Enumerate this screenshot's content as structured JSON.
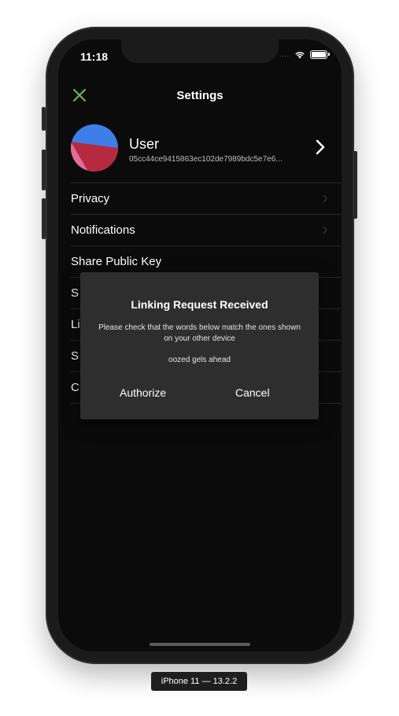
{
  "status_bar": {
    "time": "11:18",
    "signal": "....",
    "wifi_icon": "wifi-icon",
    "battery_icon": "battery-icon"
  },
  "nav": {
    "title": "Settings",
    "close_icon": "close-icon",
    "accent_color": "#6fbf40"
  },
  "profile": {
    "name": "User",
    "public_key": "05cc44ce9415863ec102de7989bdc5e7e6...",
    "chevron_icon": "chevron-right-icon"
  },
  "settings": {
    "items": [
      {
        "label": "Privacy"
      },
      {
        "label": "Notifications"
      },
      {
        "label": "Share Public Key"
      },
      {
        "label": "S"
      },
      {
        "label": "Li"
      },
      {
        "label": "S"
      },
      {
        "label": "C"
      }
    ]
  },
  "alert": {
    "title": "Linking Request Received",
    "message": "Please check that the words below match the ones shown on your other device",
    "words": "oozed gels ahead",
    "authorize_label": "Authorize",
    "cancel_label": "Cancel"
  },
  "device_label": "iPhone 11 — 13.2.2"
}
